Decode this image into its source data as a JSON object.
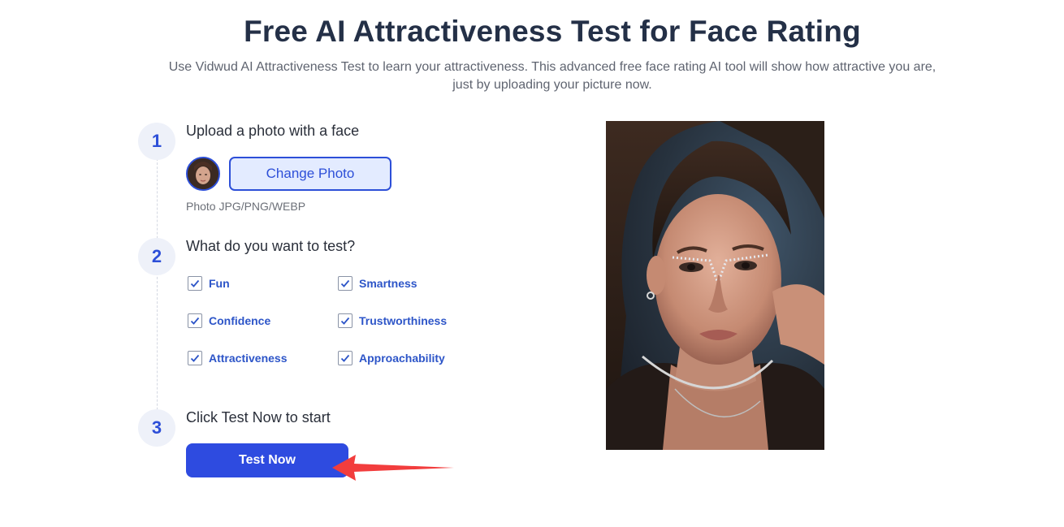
{
  "header": {
    "title": "Free AI Attractiveness Test for Face Rating",
    "subtitle": "Use Vidwud AI Attractiveness Test to learn your attractiveness. This advanced free face rating AI tool will show how attractive you are, just by uploading your picture now."
  },
  "steps": [
    {
      "number": "1",
      "title": "Upload a photo with a face"
    },
    {
      "number": "2",
      "title": "What do you want to test?"
    },
    {
      "number": "3",
      "title": "Click Test Now to start"
    }
  ],
  "upload": {
    "change_label": "Change Photo",
    "formats_hint": "Photo JPG/PNG/WEBP"
  },
  "options": [
    {
      "label": "Fun",
      "checked": true
    },
    {
      "label": "Smartness",
      "checked": true
    },
    {
      "label": "Confidence",
      "checked": true
    },
    {
      "label": "Trustworthiness",
      "checked": true
    },
    {
      "label": "Attractiveness",
      "checked": true
    },
    {
      "label": "Approachability",
      "checked": true
    }
  ],
  "action": {
    "test_label": "Test Now"
  },
  "colors": {
    "accent": "#2e4be0",
    "arrow": "#f23d3d",
    "title": "#243047"
  },
  "icons": {
    "checkbox": "check-icon",
    "pointer": "red-arrow-icon"
  }
}
